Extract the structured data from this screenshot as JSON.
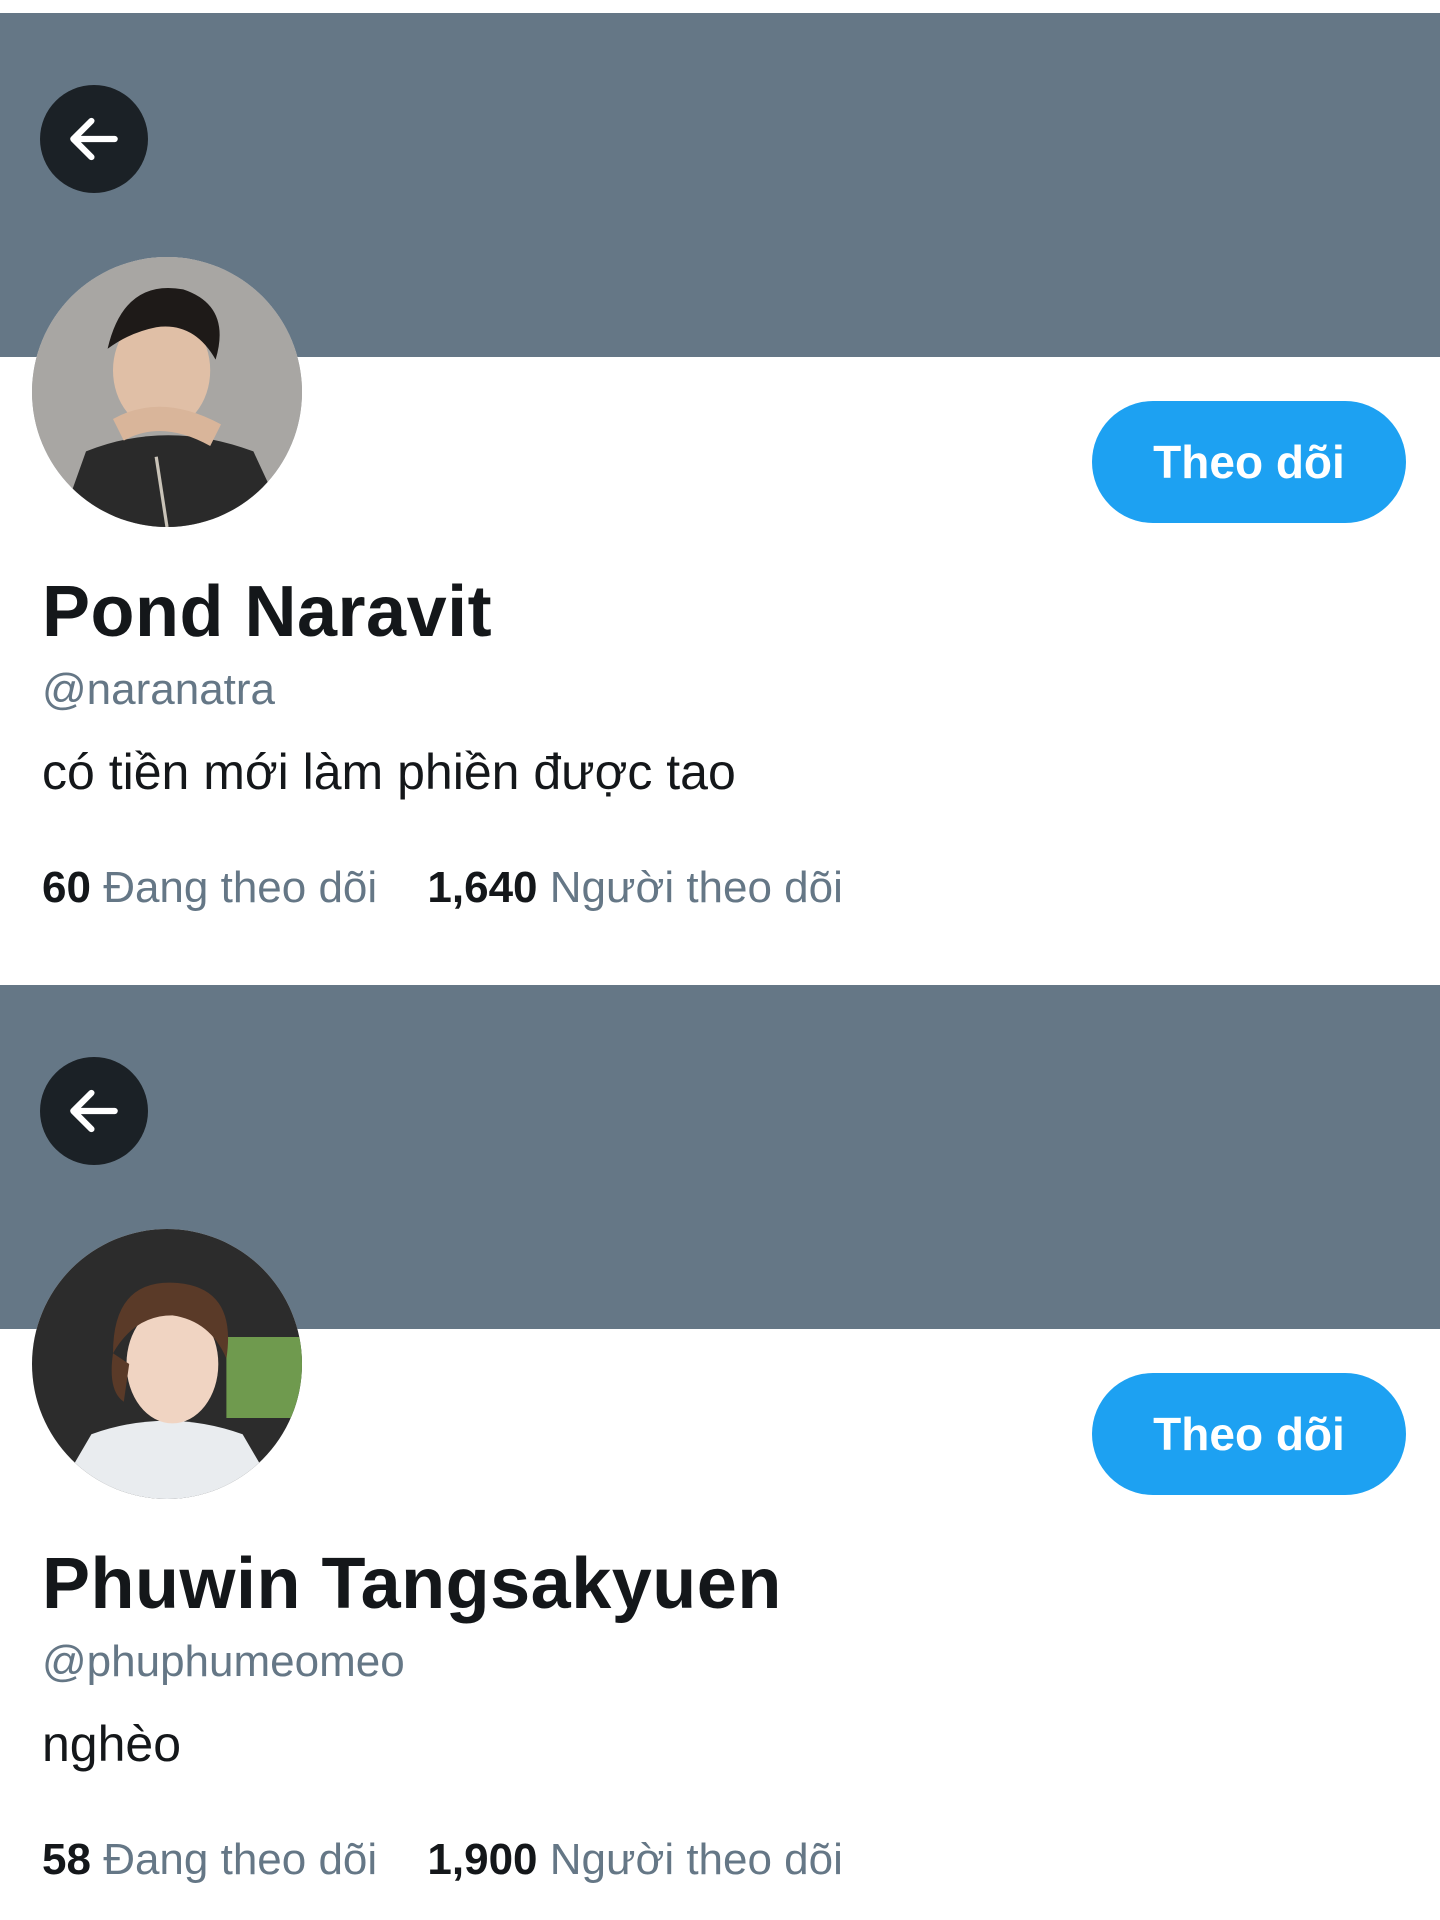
{
  "profiles": [
    {
      "name": "Pond Naravit",
      "handle": "@naranatra",
      "bio": "có tiền mới làm phiền được tao",
      "follow_label": "Theo dõi",
      "following_count": "60",
      "following_label": "Đang theo dõi",
      "followers_count": "1,640",
      "followers_label": "Người theo dõi"
    },
    {
      "name": "Phuwin Tangsakyuen",
      "handle": "@phuphumeomeo",
      "bio": "nghèo",
      "follow_label": "Theo dõi",
      "following_count": "58",
      "following_label": "Đang theo dõi",
      "followers_count": "1,900",
      "followers_label": "Người theo dõi"
    }
  ],
  "colors": {
    "banner": "#657786",
    "back_button": "#1b2126",
    "follow_button": "#1da1f2",
    "secondary_text": "#657786",
    "primary_text": "#14171a"
  },
  "icons": {
    "back": "arrow-left-icon"
  }
}
